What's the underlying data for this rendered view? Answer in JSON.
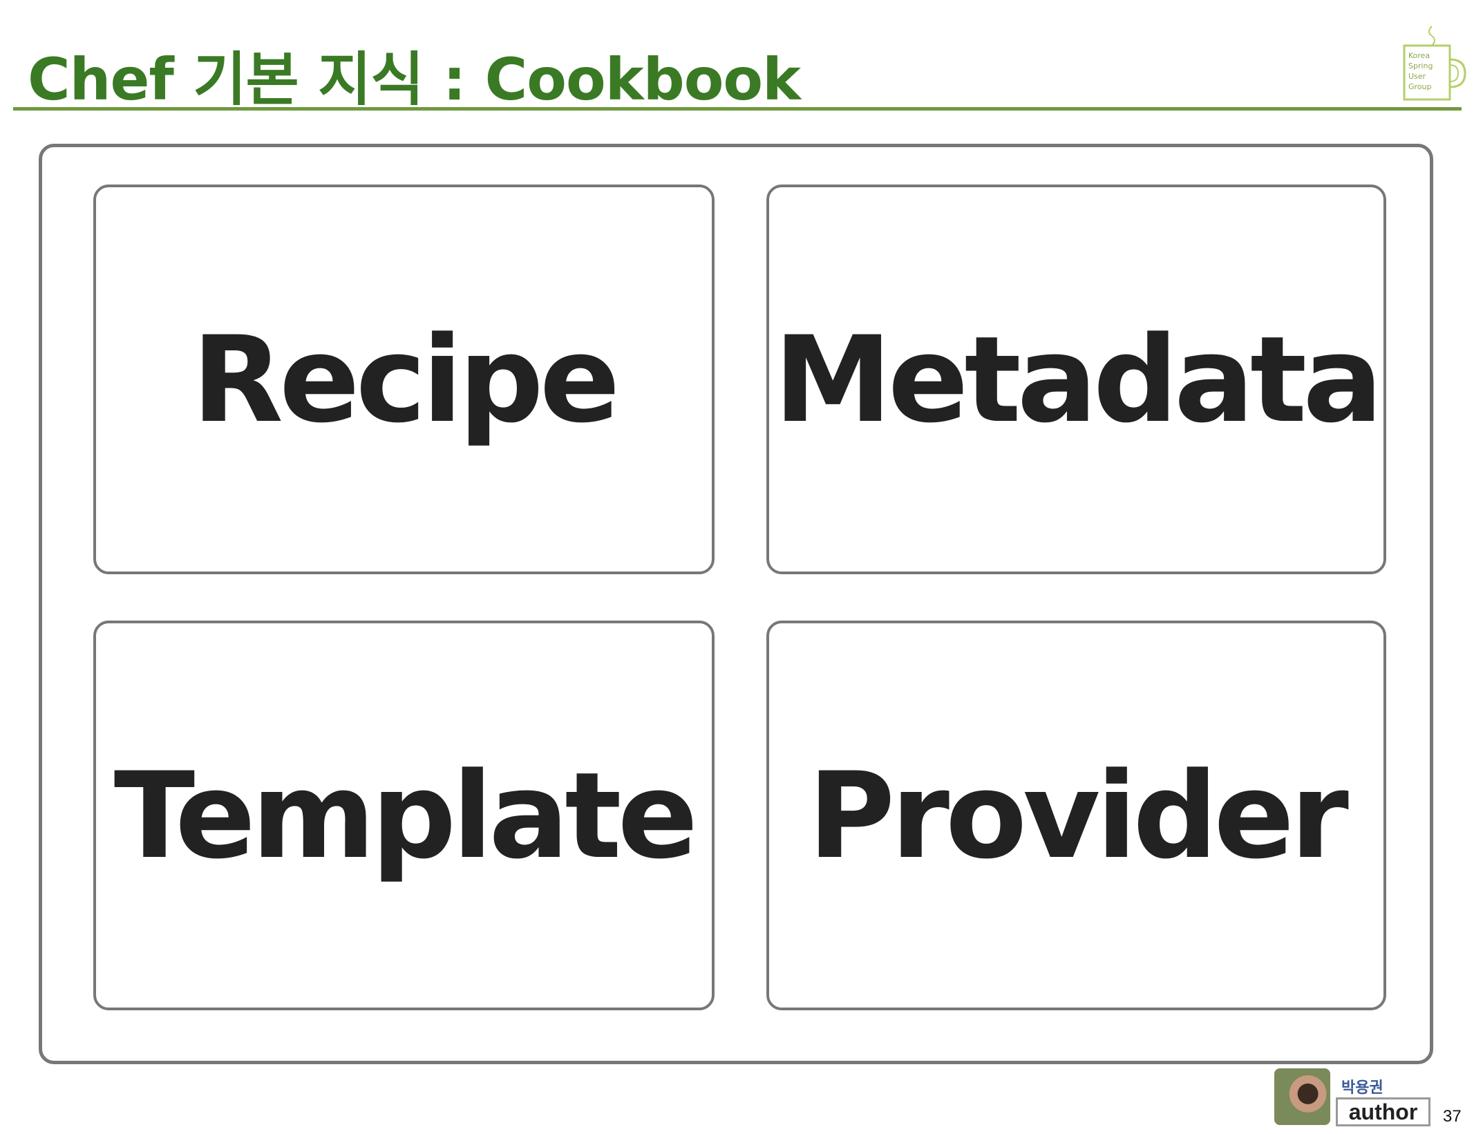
{
  "header": {
    "title": "Chef 기본 지식 : Cookbook",
    "logo_text": [
      "Korea",
      "Spring",
      "User",
      "Group"
    ]
  },
  "cards": [
    {
      "label": "Recipe"
    },
    {
      "label": "Metadata"
    },
    {
      "label": "Template"
    },
    {
      "label": "Provider"
    }
  ],
  "footer": {
    "author_name": "박용권",
    "author_label": "author",
    "page_number": "37"
  },
  "colors": {
    "title": "#3a7a25",
    "rule": "#6f9a3e",
    "logo": "#b5cf6a",
    "border": "#777777"
  }
}
